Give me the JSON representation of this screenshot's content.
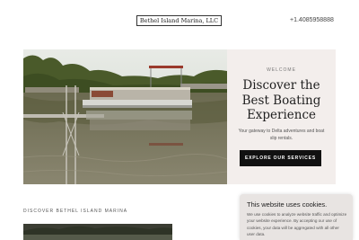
{
  "header": {
    "logo_text": "Bethel Island Marina, LLC",
    "phone": "+1.4085958888"
  },
  "hero": {
    "eyebrow": "WELCOME",
    "headline": "Discover the Best Boating Experience",
    "tagline": "Your gateway to Delta adventures and boat slip rentals.",
    "cta_label": "EXPLORE OUR SERVICES"
  },
  "section": {
    "heading": "DISCOVER BETHEL ISLAND MARINA"
  },
  "cookie_banner": {
    "title": "This website uses cookies.",
    "text": "We use cookies to analyze website traffic and optimize your website experience. By accepting our use of cookies, your data will be aggregated with all other user data."
  },
  "colors": {
    "cta_background": "#111111",
    "hero_card_background": "#f3eeec",
    "cookie_background": "#e8e4e2"
  }
}
